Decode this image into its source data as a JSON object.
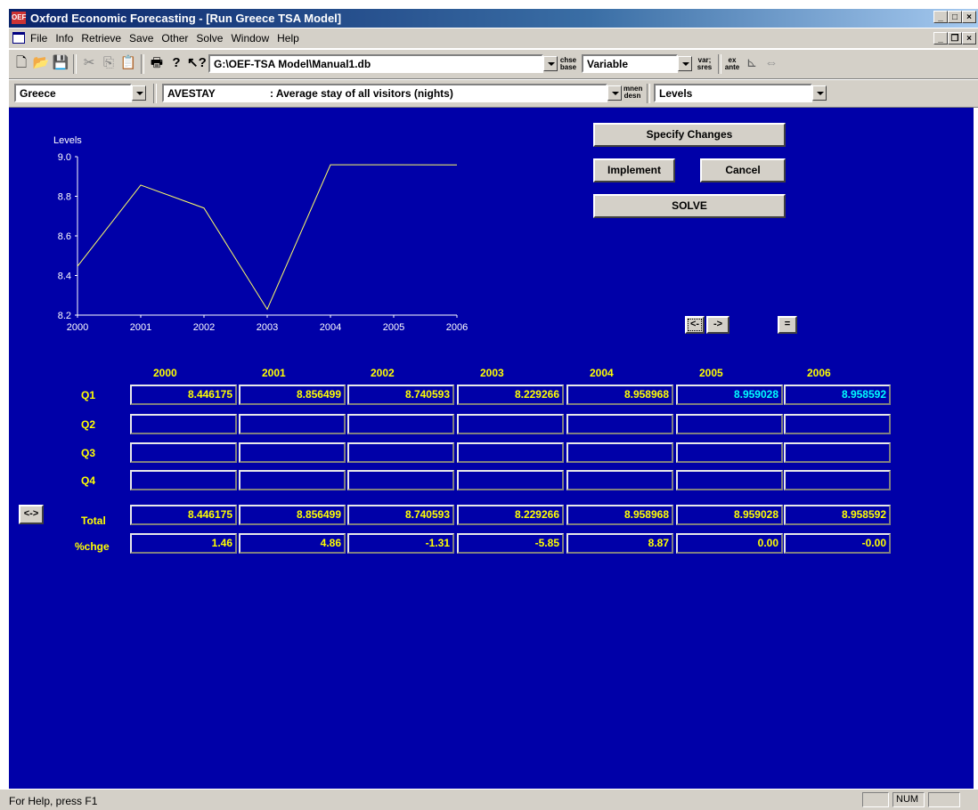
{
  "window": {
    "app_icon": "OEF",
    "title": "Oxford Economic Forecasting - [Run Greece TSA Model]"
  },
  "menu": [
    "File",
    "Info",
    "Retrieve",
    "Save",
    "Other",
    "Solve",
    "Window",
    "Help"
  ],
  "toolbar": {
    "db_path": "G:\\OEF-TSA Model\\Manual1.db",
    "chse_base": "chse\nbase",
    "selector": "Variable",
    "var_sres": "var;\nsres",
    "ex_ante": "ex\nante"
  },
  "toolbar2": {
    "country": "Greece",
    "var_code": "AVESTAY",
    "var_desc": ": Average stay of all visitors (nights)",
    "mnen_desn": "mnen\ndesn",
    "mode": "Levels"
  },
  "chart_data": {
    "type": "line",
    "ylabel": "Levels",
    "x": [
      2000,
      2001,
      2002,
      2003,
      2004,
      2005,
      2006
    ],
    "values": [
      8.446175,
      8.856499,
      8.740593,
      8.229266,
      8.958968,
      8.959028,
      8.958592
    ],
    "xlim": [
      2000,
      2006
    ],
    "ylim": [
      8.2,
      9.0
    ],
    "yticks": [
      "9.0",
      "8.8",
      "8.6",
      "8.4",
      "8.2"
    ],
    "xticks": [
      "2000",
      "2001",
      "2002",
      "2003",
      "2004",
      "2005",
      "2006"
    ],
    "line_color": "#ffff66",
    "grid": false
  },
  "buttons": {
    "specify": "Specify Changes",
    "implement": "Implement",
    "cancel": "Cancel",
    "solve": "SOLVE",
    "prev": "<-",
    "next": "->",
    "equals": "=",
    "swap": "<->"
  },
  "table": {
    "years": [
      "2000",
      "2001",
      "2002",
      "2003",
      "2004",
      "2005",
      "2006"
    ],
    "row_labels": [
      "Q1",
      "Q2",
      "Q3",
      "Q4"
    ],
    "q1": [
      "8.446175",
      "8.856499",
      "8.740593",
      "8.229266",
      "8.958968",
      "8.959028",
      "8.958592"
    ],
    "q1_highlight": [
      false,
      false,
      false,
      false,
      false,
      true,
      true
    ],
    "total_label": "Total",
    "total": [
      "8.446175",
      "8.856499",
      "8.740593",
      "8.229266",
      "8.958968",
      "8.959028",
      "8.958592"
    ],
    "chge_label": "%chge",
    "chge": [
      "1.46",
      "4.86",
      "-1.31",
      "-5.85",
      "8.87",
      "0.00",
      "-0.00"
    ]
  },
  "status": {
    "help": "For Help, press F1",
    "num": "NUM"
  },
  "colors": {
    "main_bg": "#0000a8",
    "label_yellow": "#ffff00",
    "highlight_cyan": "#00ffff"
  }
}
